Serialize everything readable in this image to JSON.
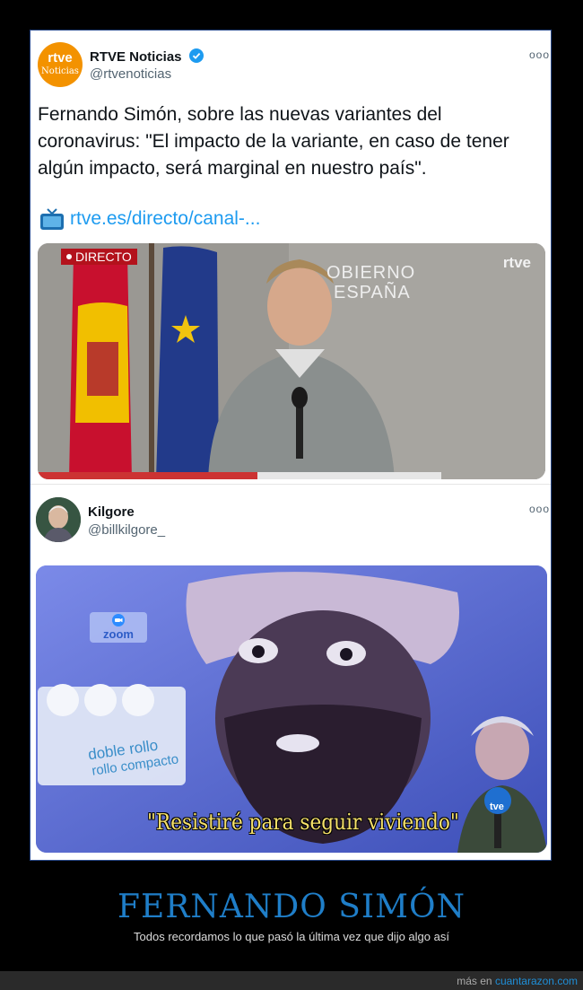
{
  "tweet1": {
    "avatar_text_1": "rtve",
    "avatar_text_2": "Noticias",
    "name": "RTVE Noticias",
    "handle": "@rtvenoticias",
    "more": "ooo",
    "text": "Fernando Simón, sobre las nuevas variantes del coronavirus: \"El impacto de la variante, en caso de tener algún impacto, será marginal en nuestro país\".",
    "link_icon": "tv-icon",
    "link": "rtve.es/directo/canal-...",
    "media": {
      "badge": "DIRECTO",
      "logo": "rtve",
      "backdrop_text_1": "OBIERNO",
      "backdrop_text_2": "ESPAÑA"
    }
  },
  "tweet2": {
    "name": "Kilgore",
    "handle": "@billkilgore_",
    "more": "ooo",
    "media": {
      "zoom_label": "zoom",
      "package_line_1": "doble rollo",
      "package_line_2": "rollo compacto",
      "caption": "\"Resistiré para seguir viviendo\"",
      "mic_logo": "tve"
    }
  },
  "meme": {
    "title": "FERNANDO SIMÓN",
    "subtitle": "Todos recordamos lo que pasó la última vez que dijo algo así"
  },
  "footer": {
    "prefix": "más en",
    "site": "cuantarazon.com"
  },
  "colors": {
    "accent": "#1d9bf0",
    "title": "#1f7ec8",
    "rtve_orange": "#f39200"
  }
}
